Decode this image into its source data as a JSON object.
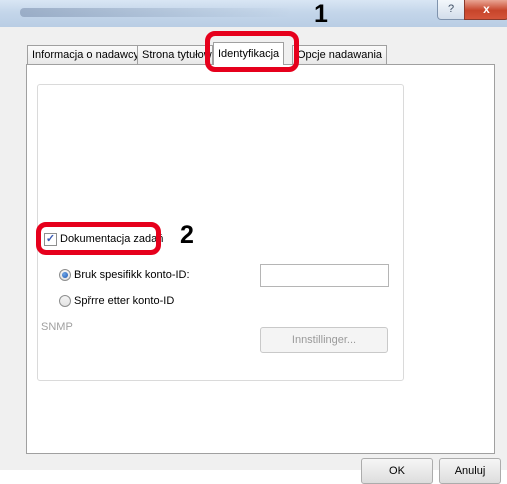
{
  "window": {
    "help_label": "?",
    "close_label": "x"
  },
  "tabs": [
    {
      "label": "Informacja o nadawcy"
    },
    {
      "label": "Strona tytułowa"
    },
    {
      "label": "Identyfikacja"
    },
    {
      "label": "Opcje nadawania"
    }
  ],
  "job_accounting": {
    "checkbox_label": "Dokumentacja zadań",
    "checked": true,
    "options": [
      {
        "label": "Bruk spesifikk konto-ID:",
        "selected": true
      },
      {
        "label": "Spřrre etter konto-ID",
        "selected": false
      }
    ],
    "account_id_value": ""
  },
  "snmp": {
    "label": "SNMP",
    "settings_button": "Innstillinger..."
  },
  "footer": {
    "ok_label": "OK",
    "cancel_label": "Anuluj"
  },
  "callouts": {
    "step1": "1",
    "step2": "2"
  },
  "colors": {
    "highlight": "#e6001c",
    "radio_selected": "#1d57b4"
  }
}
